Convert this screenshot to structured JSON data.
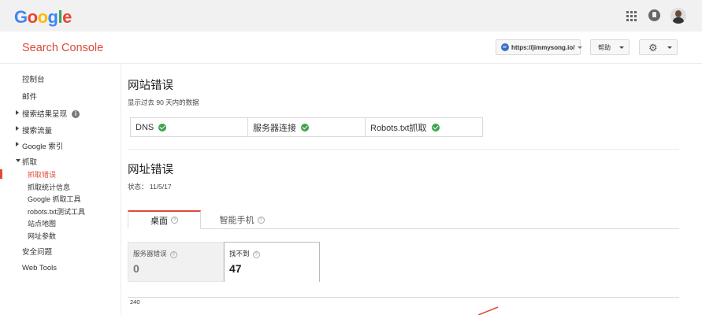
{
  "google": {
    "logo_letters": [
      {
        "ch": "G",
        "color": "#4285f4"
      },
      {
        "ch": "o",
        "color": "#ea4335"
      },
      {
        "ch": "o",
        "color": "#fbbc05"
      },
      {
        "ch": "g",
        "color": "#4285f4"
      },
      {
        "ch": "l",
        "color": "#34a853"
      },
      {
        "ch": "e",
        "color": "#ea4335"
      }
    ],
    "icons": [
      "apps-grid-icon",
      "notifications-icon",
      "account-avatar"
    ]
  },
  "console": {
    "title": "Search Console",
    "site": "https://jimmysong.io/",
    "help_label": "帮助",
    "settings_icon": "gear-icon"
  },
  "sidebar": {
    "items": [
      {
        "label": "控制台",
        "arrow": "none"
      },
      {
        "label": "邮件",
        "arrow": "none"
      },
      {
        "label": "搜索结果呈现",
        "arrow": "right",
        "info": "i"
      },
      {
        "label": "搜索流量",
        "arrow": "right"
      },
      {
        "label": "Google 索引",
        "arrow": "right"
      },
      {
        "label": "抓取",
        "arrow": "down"
      }
    ],
    "sub_items": [
      {
        "label": "抓取错误",
        "active": true
      },
      {
        "label": "抓取统计信息"
      },
      {
        "label": "Google 抓取工具"
      },
      {
        "label": "robots.txt测试工具"
      },
      {
        "label": "站点地图"
      },
      {
        "label": "网址参数"
      }
    ],
    "bottom_items": [
      {
        "label": "安全问题"
      },
      {
        "label": "Web Tools"
      }
    ],
    "accent_color": "#dd4b39"
  },
  "site_errors": {
    "title": "网站错误",
    "subtitle": "显示过去 90 天内的数据",
    "checks": [
      {
        "label": "DNS",
        "status": "ok"
      },
      {
        "label": "服务器连接",
        "status": "ok"
      },
      {
        "label": "Robots.txt抓取",
        "status": "ok"
      }
    ]
  },
  "url_errors": {
    "title": "网址错误",
    "status": "状态： 11/5/17",
    "tabs": [
      {
        "label": "桌面",
        "active": true
      },
      {
        "label": "智能手机",
        "active": false
      }
    ],
    "metrics": [
      {
        "label": "服务器错误",
        "value": "0"
      },
      {
        "label": "找不到",
        "value": "47"
      }
    ],
    "chart": {
      "y_max_label": "240",
      "line_color": "#dd4b39"
    }
  }
}
